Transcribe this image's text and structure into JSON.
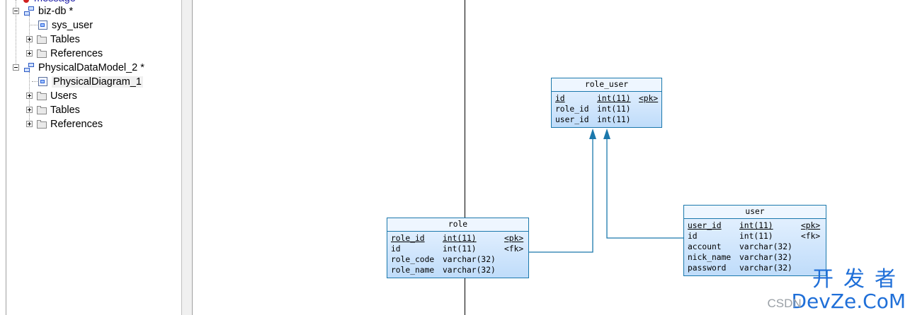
{
  "tree": {
    "items": [
      {
        "label": "message",
        "icon": "table-icon"
      },
      {
        "label": "biz-db *",
        "icon": "model-icon"
      },
      {
        "label": "sys_user",
        "icon": "diagram-icon"
      },
      {
        "label": "Tables",
        "icon": "folder-icon"
      },
      {
        "label": "References",
        "icon": "folder-icon"
      },
      {
        "label": "PhysicalDataModel_2 *",
        "icon": "model-icon"
      },
      {
        "label": "PhysicalDiagram_1",
        "icon": "diagram-icon"
      },
      {
        "label": "Users",
        "icon": "folder-icon"
      },
      {
        "label": "Tables",
        "icon": "folder-icon"
      },
      {
        "label": "References",
        "icon": "folder-icon"
      }
    ]
  },
  "diagram": {
    "entities": {
      "role_user": {
        "name": "role_user",
        "columns": [
          {
            "name": "id",
            "type": "int(11)",
            "key": "<pk>"
          },
          {
            "name": "role_id",
            "type": "int(11)",
            "key": ""
          },
          {
            "name": "user_id",
            "type": "int(11)",
            "key": ""
          }
        ]
      },
      "role": {
        "name": "role",
        "columns": [
          {
            "name": "role_id",
            "type": "int(11)",
            "key": "<pk>"
          },
          {
            "name": "id",
            "type": "int(11)",
            "key": "<fk>"
          },
          {
            "name": "role_code",
            "type": "varchar(32)",
            "key": ""
          },
          {
            "name": "role_name",
            "type": "varchar(32)",
            "key": ""
          }
        ]
      },
      "user": {
        "name": "user",
        "columns": [
          {
            "name": "user_id",
            "type": "int(11)",
            "key": "<pk>"
          },
          {
            "name": "id",
            "type": "int(11)",
            "key": "<fk>"
          },
          {
            "name": "account",
            "type": "varchar(32)",
            "key": ""
          },
          {
            "name": "nick_name",
            "type": "varchar(32)",
            "key": ""
          },
          {
            "name": "password",
            "type": "varchar(32)",
            "key": ""
          }
        ]
      }
    },
    "link_color": "#1b78ac",
    "entity_border_color": "#1b78ac"
  },
  "watermark": {
    "cn": "开发者",
    "en": "DevZe.CoM",
    "csdn": "CSDN"
  }
}
